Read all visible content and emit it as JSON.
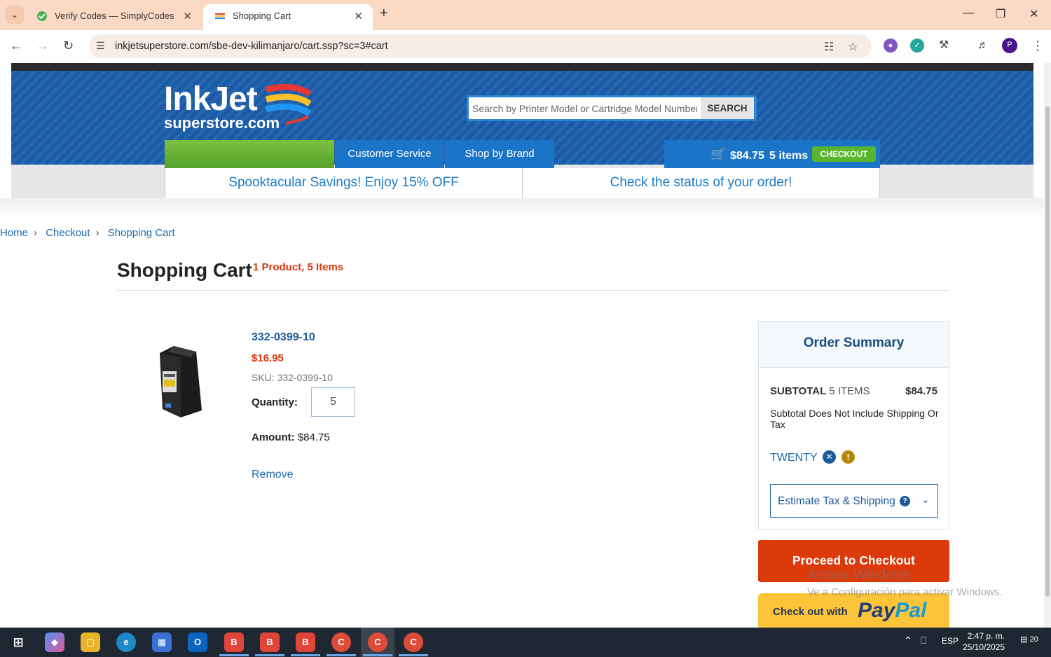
{
  "browser": {
    "tabs": [
      {
        "label": "Verify Codes — SimplyCodes",
        "close": "✕"
      },
      {
        "label": "Shopping Cart",
        "close": "✕"
      }
    ],
    "new_tab": "+",
    "url": "inkjetsuperstore.com/sbe-dev-kilimanjaro/cart.ssp?sc=3#cart",
    "profile_initial": "P"
  },
  "site": {
    "logo_main": "InkJet",
    "logo_sub": "superstore.com",
    "search_placeholder": "Search by Printer Model or Cartridge Model Number",
    "search_button": "SEARCH",
    "nav": {
      "customer_service": "Customer Service",
      "shop_by_brand": "Shop by Brand"
    },
    "cart": {
      "total": "$84.75",
      "items": "5 items",
      "checkout": "CHECKOUT"
    },
    "promos": {
      "left": "Spooktacular Savings! Enjoy 15% OFF",
      "right": "Check the status of your order!"
    }
  },
  "breadcrumb": [
    "Home",
    "Checkout",
    "Shopping Cart"
  ],
  "cart_page": {
    "title": "Shopping Cart",
    "count": "1 Product, 5 Items",
    "product": {
      "name": "332-0399-10",
      "price": "$16.95",
      "sku": "SKU: 332-0399-10",
      "quantity_label": "Quantity:",
      "quantity": "5",
      "amount_label": "Amount:",
      "amount": "$84.75",
      "remove": "Remove"
    }
  },
  "summary": {
    "title": "Order Summary",
    "subtotal_label": "SUBTOTAL",
    "subtotal_items": "5 ITEMS",
    "subtotal_value": "$84.75",
    "note": "Subtotal Does Not Include Shipping Or Tax",
    "promo_code": "TWENTY",
    "estimate": "Estimate Tax & Shipping"
  },
  "actions": {
    "proceed": "Proceed to Checkout",
    "paypal_prefix": "Check out with",
    "paypal_pay": "Pay",
    "paypal_pal": "Pal"
  },
  "watermark": {
    "line1": "Activar Windows",
    "line2": "Ve a Configuración para activar Windows."
  },
  "taskbar": {
    "language": "ESP",
    "time": "2:47 p. m.",
    "date": "25/10/2025",
    "notifications": "20"
  },
  "colors": {
    "header_blue": "#1b5ca8",
    "nav_blue": "#1a75c8",
    "accent_red": "#d8360e",
    "checkout_green": "#58b52f",
    "paypal_yellow": "#fcc439"
  }
}
